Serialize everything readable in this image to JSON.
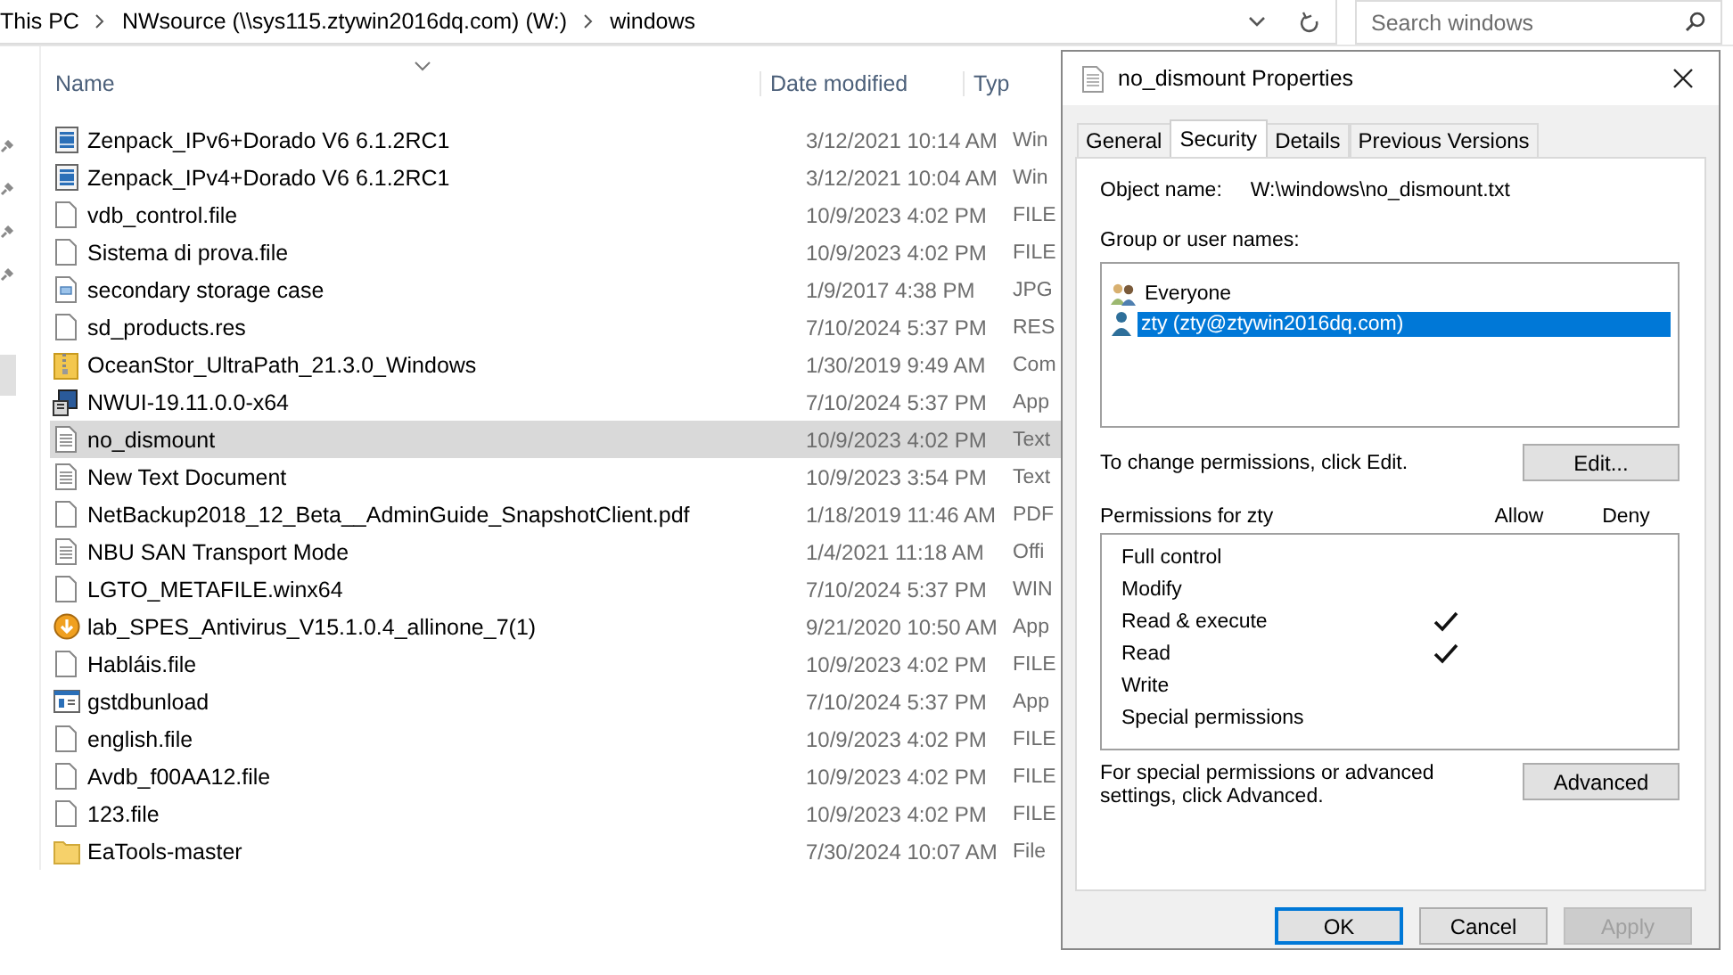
{
  "address_bar": {
    "crumbs": [
      "This PC",
      "NWsource (\\\\sys115.ztywin2016dq.com) (W:)",
      "windows"
    ]
  },
  "search": {
    "placeholder": "Search windows"
  },
  "file_list": {
    "columns": [
      "Name",
      "Date modified",
      "Typ"
    ],
    "rows": [
      {
        "name": "Zenpack_IPv6+Dorado V6 6.1.2RC1",
        "date": "3/12/2021 10:14 AM",
        "type": "Win",
        "kind": "video",
        "selected": false
      },
      {
        "name": "Zenpack_IPv4+Dorado V6 6.1.2RC1",
        "date": "3/12/2021 10:04 AM",
        "type": "Win",
        "kind": "video",
        "selected": false
      },
      {
        "name": "vdb_control.file",
        "date": "10/9/2023 4:02 PM",
        "type": "FILE",
        "kind": "blank",
        "selected": false
      },
      {
        "name": "Sistema di prova.file",
        "date": "10/9/2023 4:02 PM",
        "type": "FILE",
        "kind": "blank",
        "selected": false
      },
      {
        "name": "secondary storage case",
        "date": "1/9/2017 4:38 PM",
        "type": "JPG",
        "kind": "image",
        "selected": false
      },
      {
        "name": "sd_products.res",
        "date": "7/10/2024 5:37 PM",
        "type": "RES",
        "kind": "blank",
        "selected": false
      },
      {
        "name": "OceanStor_UltraPath_21.3.0_Windows",
        "date": "1/30/2019 9:49 AM",
        "type": "Com",
        "kind": "zip",
        "selected": false
      },
      {
        "name": "NWUI-19.11.0.0-x64",
        "date": "7/10/2024 5:37 PM",
        "type": "App",
        "kind": "installer",
        "selected": false
      },
      {
        "name": "no_dismount",
        "date": "10/9/2023 4:02 PM",
        "type": "Text",
        "kind": "text",
        "selected": true
      },
      {
        "name": "New Text Document",
        "date": "10/9/2023 3:54 PM",
        "type": "Text",
        "kind": "text",
        "selected": false
      },
      {
        "name": "NetBackup2018_12_Beta__AdminGuide_SnapshotClient.pdf",
        "date": "1/18/2019 11:46 AM",
        "type": "PDF",
        "kind": "blank",
        "selected": false
      },
      {
        "name": "NBU SAN Transport Mode",
        "date": "1/4/2021 11:18 AM",
        "type": "Offi",
        "kind": "text",
        "selected": false
      },
      {
        "name": "LGTO_METAFILE.winx64",
        "date": "7/10/2024 5:37 PM",
        "type": "WIN",
        "kind": "blank",
        "selected": false
      },
      {
        "name": "lab_SPES_Antivirus_V15.1.0.4_allinone_7(1)",
        "date": "9/21/2020 10:50 AM",
        "type": "App",
        "kind": "setup",
        "selected": false
      },
      {
        "name": "Habláis.file",
        "date": "10/9/2023 4:02 PM",
        "type": "FILE",
        "kind": "blank",
        "selected": false
      },
      {
        "name": "gstdbunload",
        "date": "7/10/2024 5:37 PM",
        "type": "App",
        "kind": "app",
        "selected": false
      },
      {
        "name": "english.file",
        "date": "10/9/2023 4:02 PM",
        "type": "FILE",
        "kind": "blank",
        "selected": false
      },
      {
        "name": "Avdb_f00AA12.file",
        "date": "10/9/2023 4:02 PM",
        "type": "FILE",
        "kind": "blank",
        "selected": false
      },
      {
        "name": "123.file",
        "date": "10/9/2023 4:02 PM",
        "type": "FILE",
        "kind": "blank",
        "selected": false
      },
      {
        "name": "EaTools-master",
        "date": "7/30/2024 10:07 AM",
        "type": "File",
        "kind": "folder",
        "selected": false
      }
    ]
  },
  "dialog": {
    "title": "no_dismount Properties",
    "tabs": [
      {
        "label": "General",
        "selected": false
      },
      {
        "label": "Security",
        "selected": true
      },
      {
        "label": "Details",
        "selected": false
      },
      {
        "label": "Previous Versions",
        "selected": false
      }
    ],
    "object_label": "Object name:",
    "object_value": "W:\\windows\\no_dismount.txt",
    "users_label": "Group or user names:",
    "users": [
      {
        "name": "Everyone",
        "kind": "group",
        "selected": false
      },
      {
        "name": "zty (zty@ztywin2016dq.com)",
        "kind": "user",
        "selected": true
      }
    ],
    "edit_hint": "To change permissions, click Edit.",
    "edit_button": "Edit...",
    "permissions_label": "Permissions for zty",
    "allow_label": "Allow",
    "deny_label": "Deny",
    "permissions": [
      {
        "name": "Full control",
        "allow": false,
        "deny": false
      },
      {
        "name": "Modify",
        "allow": false,
        "deny": false
      },
      {
        "name": "Read & execute",
        "allow": true,
        "deny": false
      },
      {
        "name": "Read",
        "allow": true,
        "deny": false
      },
      {
        "name": "Write",
        "allow": false,
        "deny": false
      },
      {
        "name": "Special permissions",
        "allow": false,
        "deny": false
      }
    ],
    "advanced_hint": "For special permissions or advanced settings, click Advanced.",
    "advanced_button": "Advanced",
    "buttons": [
      {
        "label": "OK",
        "kind": "default",
        "disabled": false
      },
      {
        "label": "Cancel",
        "kind": "normal",
        "disabled": false
      },
      {
        "label": "Apply",
        "kind": "normal",
        "disabled": true
      }
    ]
  }
}
